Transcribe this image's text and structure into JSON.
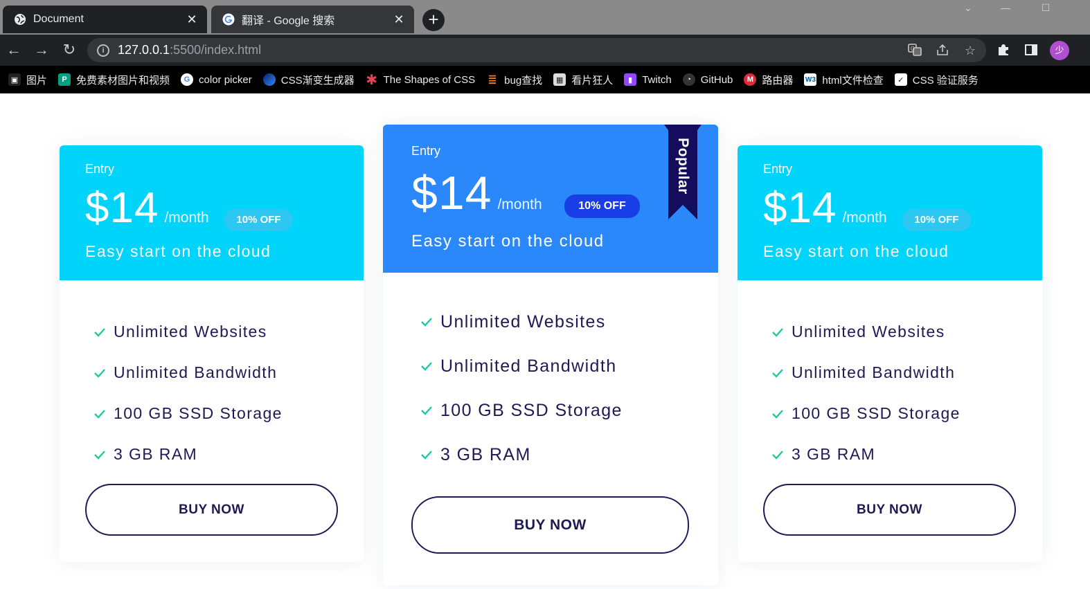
{
  "browser": {
    "tabs": [
      {
        "title": "Document",
        "active": true,
        "icon": "globe-icon"
      },
      {
        "title": "翻译 - Google 搜索",
        "active": false,
        "icon": "google-icon"
      }
    ],
    "new_tab": "+",
    "url": {
      "host": "127.0.0.1",
      "path": ":5500/index.html"
    },
    "profile_initial": "少",
    "bookmarks": [
      {
        "label": "图片",
        "icon": "image-icon",
        "color": "#222222"
      },
      {
        "label": "免费素材图片和视频",
        "icon": "pexels-icon",
        "color": "#05a081"
      },
      {
        "label": "color picker",
        "icon": "google-icon",
        "color": "#ffffff"
      },
      {
        "label": "CSS渐变生成器",
        "icon": "gradient-icon",
        "color": "#1e6ad6"
      },
      {
        "label": "The Shapes of CSS",
        "icon": "asterisk-icon",
        "color": "#e8425a"
      },
      {
        "label": "bug查找",
        "icon": "stackoverflow-icon",
        "color": "#f48024"
      },
      {
        "label": "看片狂人",
        "icon": "film-icon",
        "color": "#dddddd"
      },
      {
        "label": "Twitch",
        "icon": "twitch-icon",
        "color": "#9146ff"
      },
      {
        "label": "GitHub",
        "icon": "github-icon",
        "color": "#333333"
      },
      {
        "label": "路由器",
        "icon": "router-icon",
        "color": "#e02a3a"
      },
      {
        "label": "html文件检查",
        "icon": "w3c-icon",
        "color": "#ffffff"
      },
      {
        "label": "CSS 验证服务",
        "icon": "css-validator-icon",
        "color": "#ffffff"
      }
    ]
  },
  "pricing": {
    "cards": [
      {
        "tier": "Entry",
        "price": "$14",
        "period": "/month",
        "discount": "10% OFF",
        "tagline": "Easy start on the cloud",
        "features": [
          "Unlimited Websites",
          "Unlimited Bandwidth",
          "100 GB SSD Storage",
          "3 GB RAM"
        ],
        "cta": "BUY NOW"
      },
      {
        "tier": "Entry",
        "price": "$14",
        "period": "/month",
        "discount": "10% OFF",
        "tagline": "Easy start on the cloud",
        "ribbon": "Popular",
        "features": [
          "Unlimited Websites",
          "Unlimited Bandwidth",
          "100 GB SSD Storage",
          "3 GB RAM"
        ],
        "cta": "BUY NOW"
      },
      {
        "tier": "Entry",
        "price": "$14",
        "period": "/month",
        "discount": "10% OFF",
        "tagline": "Easy start on the cloud",
        "features": [
          "Unlimited Websites",
          "Unlimited Bandwidth",
          "100 GB SSD Storage",
          "3 GB RAM"
        ],
        "cta": "BUY NOW"
      }
    ]
  },
  "colors": {
    "side_header": "#00d4fb",
    "featured_header": "#2a88fa",
    "featured_badge": "#1a3ee6",
    "ribbon": "#140c5c",
    "check": "#1ec9a0",
    "text_dark": "#1d1a55"
  }
}
